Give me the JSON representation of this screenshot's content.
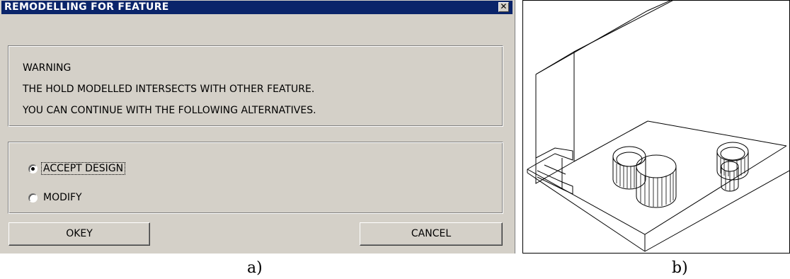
{
  "dialog": {
    "title": "REMODELLING FOR FEATURE",
    "close_glyph": "✕",
    "message": {
      "line1": "WARNING",
      "line2": "THE HOLD MODELLED INTERSECTS WITH OTHER FEATURE.",
      "line3": "YOU CAN CONTINUE WITH THE FOLLOWING ALTERNATIVES."
    },
    "options": [
      {
        "label": "ACCEPT DESIGN",
        "checked": true
      },
      {
        "label": "MODIFY",
        "checked": false
      }
    ],
    "buttons": {
      "okey_label": "OKEY",
      "cancel_label": "CANCEL"
    }
  },
  "captions": {
    "a": "a)",
    "b": "b)"
  },
  "colors": {
    "titlebar": "#0a246a",
    "dialog_bg": "#d4d0c8"
  }
}
